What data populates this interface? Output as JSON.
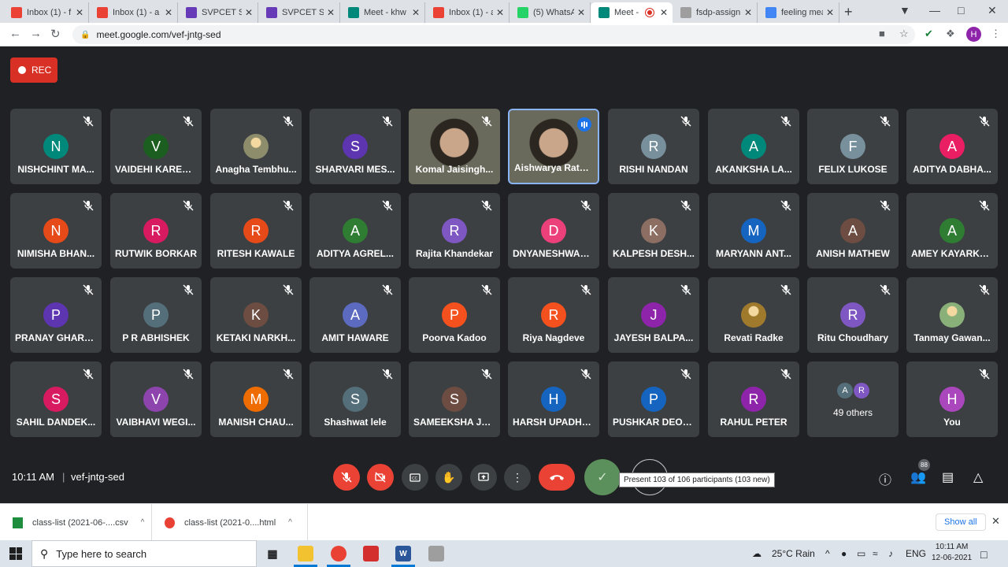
{
  "browser": {
    "tabs": [
      {
        "title": "Inbox (1) - f",
        "icon": "gmail-icon",
        "active": false
      },
      {
        "title": "Inbox (1) - a",
        "icon": "gmail-icon",
        "active": false
      },
      {
        "title": "SVPCET Stu",
        "icon": "forms-icon",
        "active": false
      },
      {
        "title": "SVPCET Stu",
        "icon": "forms-icon",
        "active": false
      },
      {
        "title": "Meet - khw",
        "icon": "meet-icon",
        "active": false
      },
      {
        "title": "Inbox (1) - a",
        "icon": "gmail-icon",
        "active": false
      },
      {
        "title": "(5) WhatsAp",
        "icon": "whatsapp-icon",
        "active": false
      },
      {
        "title": "Meet -",
        "icon": "meet-icon",
        "active": true
      },
      {
        "title": "fsdp-assign",
        "icon": "page-icon",
        "active": false
      },
      {
        "title": "feeling mea",
        "icon": "google-icon",
        "active": false
      }
    ],
    "url": "meet.google.com/vef-jntg-sed",
    "profile_initial": "H"
  },
  "meet": {
    "rec_label": "REC",
    "participants": [
      {
        "name": "NISHCHINT MA...",
        "initial": "N",
        "color": "#00897b"
      },
      {
        "name": "VAIDEHI KAREM...",
        "initial": "V",
        "color": "#1b5e20"
      },
      {
        "name": "Anagha Tembhu...",
        "initial": "",
        "color": "#8d8d6c",
        "photo": true
      },
      {
        "name": "SHARVARI MES...",
        "initial": "S",
        "color": "#5e35b1"
      },
      {
        "name": "Komal Jaisingh...",
        "initial": "",
        "color": "#6a6a5c",
        "video": true
      },
      {
        "name": "Aishwarya Rath...",
        "initial": "",
        "color": "#6a6a5c",
        "video": true,
        "speaking": true
      },
      {
        "name": "RISHI NANDAN",
        "initial": "R",
        "color": "#78909c"
      },
      {
        "name": "AKANKSHA LA...",
        "initial": "A",
        "color": "#00897b"
      },
      {
        "name": "FELIX LUKOSE",
        "initial": "F",
        "color": "#78909c"
      },
      {
        "name": "ADITYA DABHA...",
        "initial": "A",
        "color": "#e91e63"
      },
      {
        "name": "NIMISHA BHAN...",
        "initial": "N",
        "color": "#e64a19"
      },
      {
        "name": "RUTWIK BORKAR",
        "initial": "R",
        "color": "#d81b60"
      },
      {
        "name": "RITESH KAWALE",
        "initial": "R",
        "color": "#e64a19"
      },
      {
        "name": "ADITYA AGREL...",
        "initial": "A",
        "color": "#2e7d32"
      },
      {
        "name": "Rajita Khandekar",
        "initial": "R",
        "color": "#7e57c2"
      },
      {
        "name": "DNYANESHWAR...",
        "initial": "D",
        "color": "#ec407a"
      },
      {
        "name": "KALPESH DESH...",
        "initial": "K",
        "color": "#8d6e63"
      },
      {
        "name": "MARYANN ANT...",
        "initial": "M",
        "color": "#1565c0"
      },
      {
        "name": "ANISH MATHEW",
        "initial": "A",
        "color": "#6d4c41"
      },
      {
        "name": "AMEY KAYARKAR",
        "initial": "A",
        "color": "#2e7d32"
      },
      {
        "name": "PRANAY GHARDE",
        "initial": "P",
        "color": "#5e35b1"
      },
      {
        "name": "P R ABHISHEK",
        "initial": "P",
        "color": "#546e7a"
      },
      {
        "name": "KETAKI NARKH...",
        "initial": "K",
        "color": "#6d4c41"
      },
      {
        "name": "AMIT HAWARE",
        "initial": "A",
        "color": "#5c6bc0"
      },
      {
        "name": "Poorva Kadoo",
        "initial": "P",
        "color": "#f4511e"
      },
      {
        "name": "Riya Nagdeve",
        "initial": "R",
        "color": "#f4511e"
      },
      {
        "name": "JAYESH BALPA...",
        "initial": "J",
        "color": "#8e24aa"
      },
      {
        "name": "Revati Radke",
        "initial": "",
        "color": "#a07a2c",
        "photo": true
      },
      {
        "name": "Ritu Choudhary",
        "initial": "R",
        "color": "#7e57c2"
      },
      {
        "name": "Tanmay Gawan...",
        "initial": "",
        "color": "#8ab07a",
        "photo": true
      },
      {
        "name": "SAHIL DANDEK...",
        "initial": "S",
        "color": "#d81b60"
      },
      {
        "name": "VAIBHAVI WEGI...",
        "initial": "V",
        "color": "#8e44ad"
      },
      {
        "name": "MANISH CHAU...",
        "initial": "M",
        "color": "#ef6c00"
      },
      {
        "name": "Shashwat lele",
        "initial": "S",
        "color": "#546e7a"
      },
      {
        "name": "SAMEEKSHA JA...",
        "initial": "S",
        "color": "#6d4c41"
      },
      {
        "name": "HARSH UPADHY...",
        "initial": "H",
        "color": "#1565c0"
      },
      {
        "name": "PUSHKAR DEOT...",
        "initial": "P",
        "color": "#1565c0"
      },
      {
        "name": "RAHUL PETER",
        "initial": "R",
        "color": "#8e24aa"
      }
    ],
    "others": {
      "label": "49 others",
      "avatars": [
        {
          "initial": "A",
          "color": "#546e7a"
        },
        {
          "initial": "R",
          "color": "#7e57c2"
        }
      ]
    },
    "self": {
      "name": "You",
      "initial": "H",
      "color": "#ab47bc"
    },
    "time": "10:11 AM",
    "meeting_code": "vef-jntg-sed",
    "tooltip": "Present 103 of 106 participants (103 new)",
    "participants_count": "88"
  },
  "downloads": {
    "items": [
      {
        "name": "class-list (2021-06-....csv",
        "icon": "csv-icon"
      },
      {
        "name": "class-list (2021-0....html",
        "icon": "chrome-icon"
      }
    ],
    "show_all": "Show all"
  },
  "taskbar": {
    "search_placeholder": "Type here to search",
    "weather": "25°C  Rain",
    "lang": "ENG",
    "time": "10:11 AM",
    "date": "12-06-2021"
  }
}
